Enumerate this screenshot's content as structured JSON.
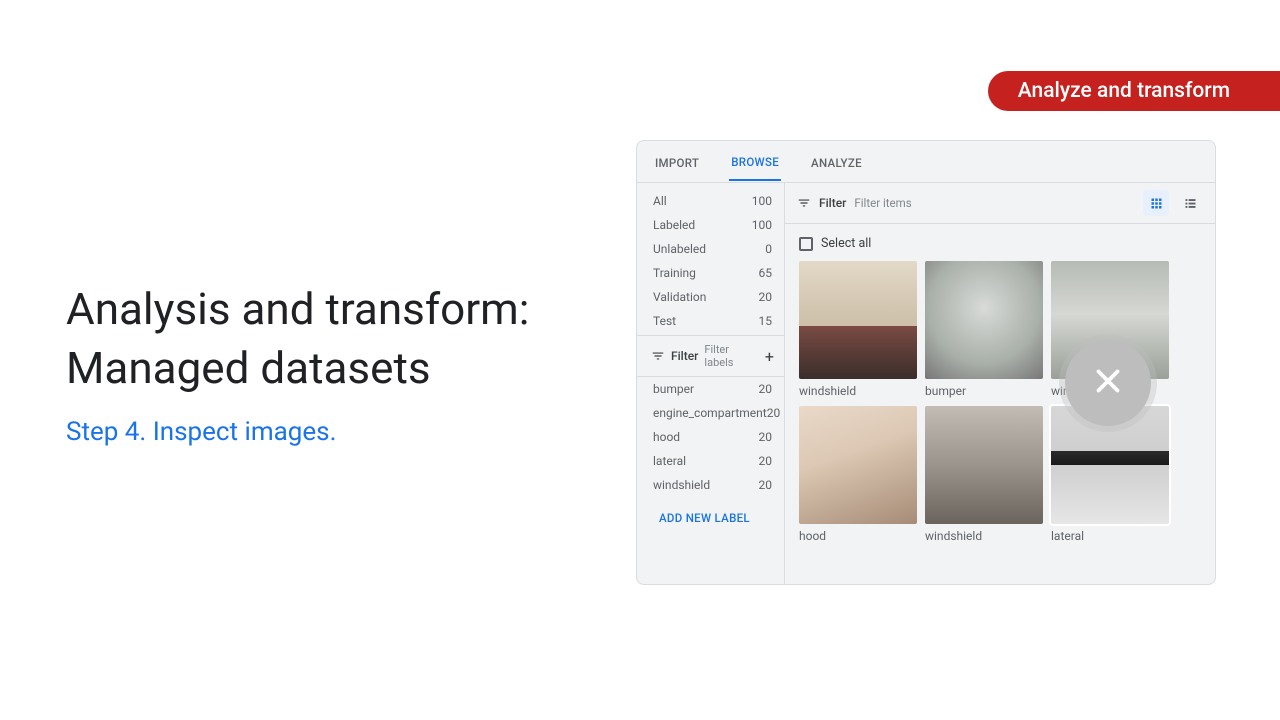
{
  "tag": "Analyze and transform",
  "title_line1": "Analysis and transform:",
  "title_line2": "Managed datasets",
  "step": "Step 4. Inspect images.",
  "tabs": {
    "import": "IMPORT",
    "browse": "BROWSE",
    "analyze": "ANALYZE"
  },
  "sidebar": {
    "subsets": [
      {
        "label": "All",
        "count": "100"
      },
      {
        "label": "Labeled",
        "count": "100"
      },
      {
        "label": "Unlabeled",
        "count": "0"
      },
      {
        "label": "Training",
        "count": "65"
      },
      {
        "label": "Validation",
        "count": "20"
      },
      {
        "label": "Test",
        "count": "15"
      }
    ],
    "filter_label": "Filter",
    "filter_placeholder": "Filter labels",
    "labels": [
      {
        "label": "bumper",
        "count": "20"
      },
      {
        "label": "engine_compartment",
        "count": "20"
      },
      {
        "label": "hood",
        "count": "20"
      },
      {
        "label": "lateral",
        "count": "20"
      },
      {
        "label": "windshield",
        "count": "20"
      }
    ],
    "add_new": "ADD NEW LABEL"
  },
  "toolbar": {
    "filter_label": "Filter",
    "filter_placeholder": "Filter items",
    "select_all": "Select all"
  },
  "items": [
    {
      "label": "windshield"
    },
    {
      "label": "bumper"
    },
    {
      "label": "windshield"
    },
    {
      "label": "hood"
    },
    {
      "label": "windshield"
    },
    {
      "label": "lateral"
    }
  ]
}
